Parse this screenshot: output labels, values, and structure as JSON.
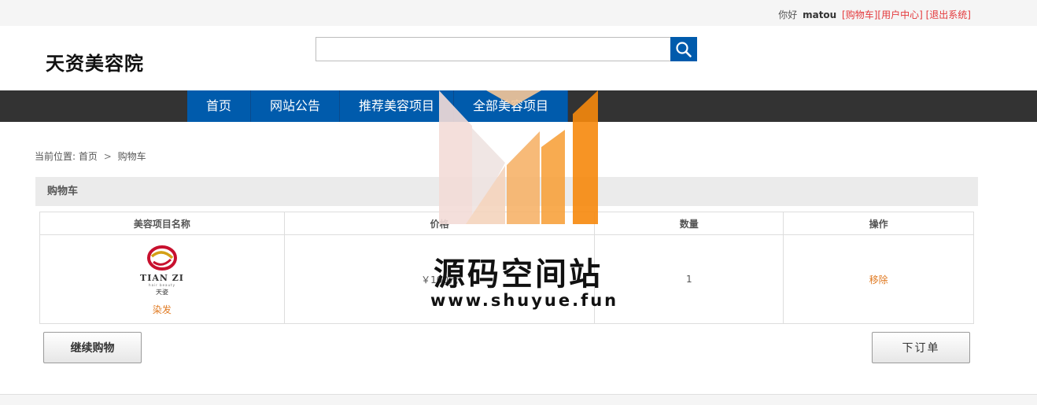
{
  "topbar": {
    "greeting": "你好",
    "username": "matou",
    "cart_link": "[购物车]",
    "user_center_link": "[用户中心]",
    "logout_link": "[退出系统]"
  },
  "header": {
    "logo_text": "天资美容院",
    "search": {
      "value": "",
      "placeholder": ""
    }
  },
  "nav": {
    "items": [
      {
        "label": "首页"
      },
      {
        "label": "网站公告"
      },
      {
        "label": "推荐美容项目"
      },
      {
        "label": "全部美容项目"
      }
    ]
  },
  "breadcrumb": {
    "prefix": "当前位置:",
    "home": "首页",
    "separator": ">",
    "current": "购物车"
  },
  "cart": {
    "title": "购物车",
    "columns": [
      "美容项目名称",
      "价格",
      "数量",
      "操作"
    ],
    "rows": [
      {
        "logo_text": "TIAN ZI",
        "logo_subtext": "hair beauty",
        "logo_cn": "天姿",
        "name": "染发",
        "price": "￥100元",
        "quantity": "1",
        "action": "移除"
      }
    ]
  },
  "buttons": {
    "continue_shopping": "继续购物",
    "place_order": "下订单"
  },
  "watermark": {
    "title": "源码空间站",
    "url": "www.shuyue.fun"
  },
  "colors": {
    "brand_blue": "#005bac",
    "nav_dark": "#333333",
    "link_red": "#e4393c",
    "action_orange": "#e07a22"
  }
}
